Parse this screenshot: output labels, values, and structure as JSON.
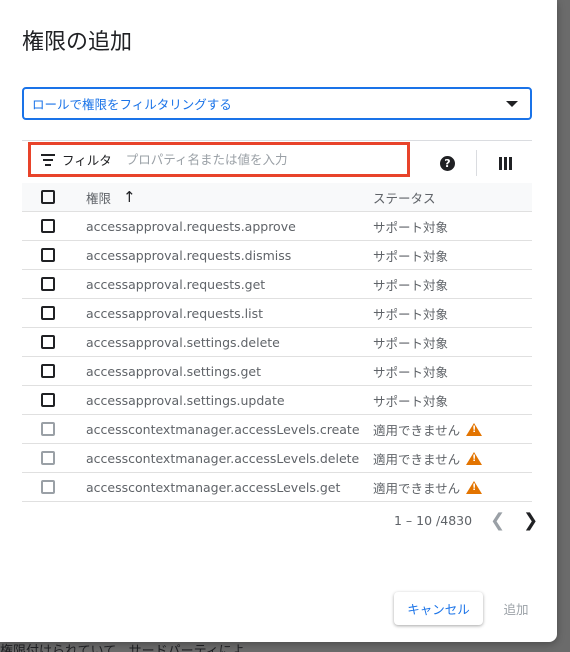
{
  "background": {
    "text": "権限付けられていて、サードパーティによ"
  },
  "dialog": {
    "title": "権限の追加",
    "role_filter": {
      "label": "ロールで権限をフィルタリングする"
    },
    "filter": {
      "label": "フィルタ",
      "placeholder": "プロパティ名または値を入力"
    },
    "icons": {
      "help": "help-icon",
      "columns": "columns-icon",
      "filter": "filter-icon"
    },
    "table": {
      "headers": {
        "permission": "権限",
        "status": "ステータス"
      },
      "rows": [
        {
          "permission": "accessapproval.requests.approve",
          "status": "サポート対象"
        },
        {
          "permission": "accessapproval.requests.dismiss",
          "status": "サポート対象"
        },
        {
          "permission": "accessapproval.requests.get",
          "status": "サポート対象"
        },
        {
          "permission": "accessapproval.requests.list",
          "status": "サポート対象"
        },
        {
          "permission": "accessapproval.settings.delete",
          "status": "サポート対象"
        },
        {
          "permission": "accessapproval.settings.get",
          "status": "サポート対象"
        },
        {
          "permission": "accessapproval.settings.update",
          "status": "サポート対象"
        },
        {
          "permission": "accesscontextmanager.accessLevels.create",
          "status": "適用できません"
        },
        {
          "permission": "accesscontextmanager.accessLevels.delete",
          "status": "適用できません"
        },
        {
          "permission": "accesscontextmanager.accessLevels.get",
          "status": "適用できません"
        }
      ]
    },
    "pagination": {
      "range": "1 – 10 /4830"
    },
    "buttons": {
      "cancel": "キャンセル",
      "add": "追加"
    },
    "colors": {
      "accent": "#1a73e8",
      "highlight": "#e8432a",
      "warning": "#e37400"
    }
  }
}
